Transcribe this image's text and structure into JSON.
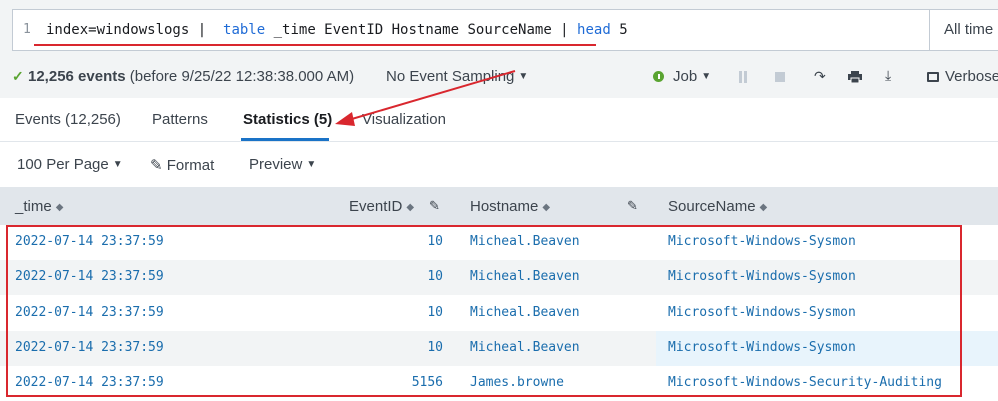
{
  "search": {
    "line_number": "1",
    "query_part1": "index=windowslogs |  ",
    "query_kw1": "table",
    "query_part2": " _time EventID Hostname SourceName | ",
    "query_kw2": "head",
    "query_part3": " 5",
    "time_range": "All time"
  },
  "status": {
    "event_count": "12,256 events",
    "event_before": " (before 9/25/22 12:38:38.000 AM)",
    "sampling": "No Event Sampling",
    "job": "Job",
    "mode": "Verbose"
  },
  "tabs": [
    {
      "label": "Events (12,256)"
    },
    {
      "label": "Patterns"
    },
    {
      "label": "Statistics (5)"
    },
    {
      "label": "Visualization"
    }
  ],
  "toolbar": {
    "per_page": "100 Per Page",
    "format": "Format",
    "preview": "Preview"
  },
  "table": {
    "columns": [
      "_time",
      "EventID",
      "Hostname",
      "SourceName"
    ],
    "rows": [
      [
        "2022-07-14 23:37:59",
        "10",
        "Micheal.Beaven",
        "Microsoft-Windows-Sysmon"
      ],
      [
        "2022-07-14 23:37:59",
        "10",
        "Micheal.Beaven",
        "Microsoft-Windows-Sysmon"
      ],
      [
        "2022-07-14 23:37:59",
        "10",
        "Micheal.Beaven",
        "Microsoft-Windows-Sysmon"
      ],
      [
        "2022-07-14 23:37:59",
        "10",
        "Micheal.Beaven",
        "Microsoft-Windows-Sysmon"
      ],
      [
        "2022-07-14 23:37:59",
        "5156",
        "James.browne",
        "Microsoft-Windows-Security-Auditing"
      ]
    ]
  },
  "colors": {
    "accent_blue": "#1a73c7",
    "annotation_red": "#d9272e",
    "success_green": "#5aa431"
  }
}
